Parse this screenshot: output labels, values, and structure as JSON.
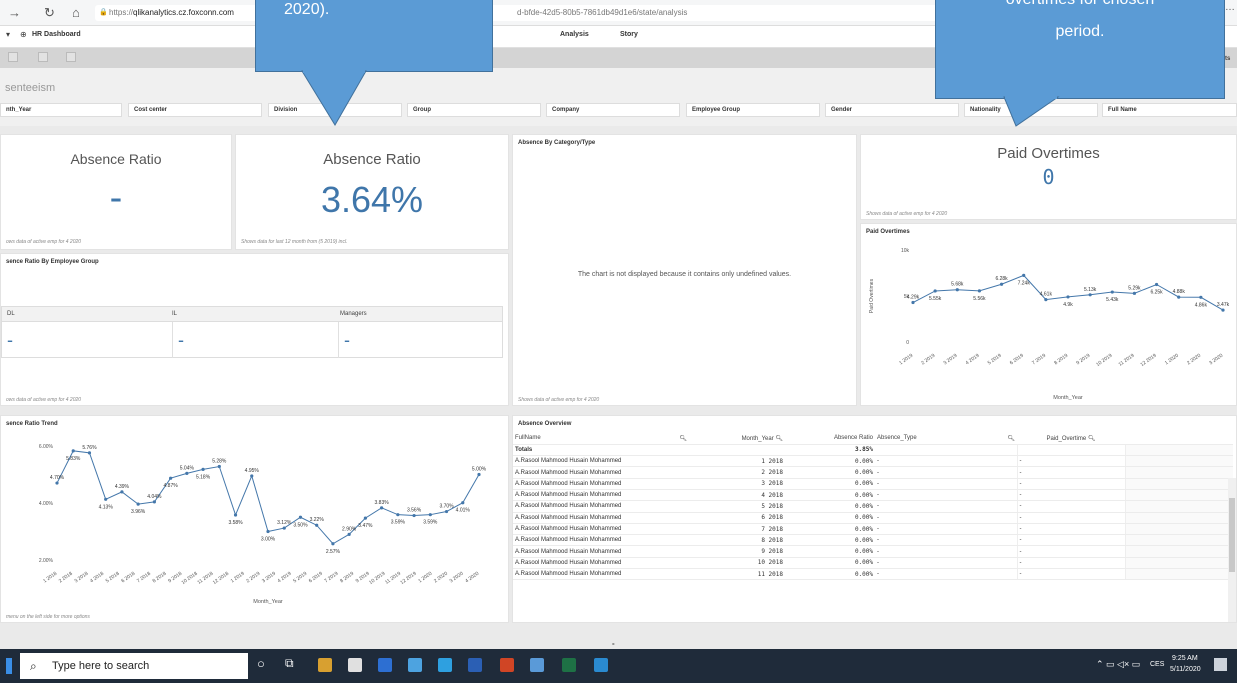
{
  "browser": {
    "url_prefix": "https://",
    "url_host": "qlikanalytics.cz.foxconn.com",
    "url_rest": "d-bfde-42d5-80b5-7861db49d1e6/state/analysis"
  },
  "app": {
    "name": "HR Dashboard",
    "tabs": [
      "Analysis",
      "Story"
    ],
    "toolbar_right": "ts"
  },
  "sheet": {
    "title": "senteeism"
  },
  "filters": [
    "nth_Year",
    "Cost center",
    "Division",
    "Group",
    "Company",
    "Employee Group",
    "Gender",
    "Nationality",
    "Full Name"
  ],
  "kpi_left": {
    "title": "Absence Ratio",
    "value": "-",
    "footer": "ows data of active emp for 4 2020"
  },
  "kpi_mid": {
    "title": "Absence Ratio",
    "value": "3.64%",
    "footer": "Shows data for last 12 month from (5 2019) incl."
  },
  "category": {
    "title": "Absence By Category/Type",
    "message": "The chart is not displayed because it contains only undefined values.",
    "footer": "Shows data of active emp for 4 2020"
  },
  "paid_kpi": {
    "title": "Paid Overtimes",
    "value": "0",
    "footer": "Shows data of active emp for 4 2020"
  },
  "emp_group": {
    "title": "sence Ratio By Employee Group",
    "columns": [
      "DL",
      "IL",
      "Managers"
    ],
    "values": [
      "-",
      "-",
      "-"
    ],
    "footer": "ows data of active emp for 4 2020"
  },
  "trend": {
    "title": "sence Ratio Trend",
    "footer": "menu on the left side for more options"
  },
  "overview": {
    "title": "Absence Overview",
    "headers": [
      "FullName",
      "Month_Year",
      "Absence Ratio",
      "Absence_Type",
      "Paid_Overtime"
    ],
    "totals": [
      "Totals",
      "",
      "3.85%",
      "",
      ""
    ],
    "rows": [
      [
        "A.Rasool Mahmood Husain Mohammed",
        "1 2018",
        "0.00%",
        "-",
        "-"
      ],
      [
        "A.Rasool Mahmood Husain Mohammed",
        "2 2018",
        "0.00%",
        "-",
        "-"
      ],
      [
        "A.Rasool Mahmood Husain Mohammed",
        "3 2018",
        "0.00%",
        "-",
        "-"
      ],
      [
        "A.Rasool Mahmood Husain Mohammed",
        "4 2018",
        "0.00%",
        "-",
        "-"
      ],
      [
        "A.Rasool Mahmood Husain Mohammed",
        "5 2018",
        "0.00%",
        "-",
        "-"
      ],
      [
        "A.Rasool Mahmood Husain Mohammed",
        "6 2018",
        "0.00%",
        "-",
        "-"
      ],
      [
        "A.Rasool Mahmood Husain Mohammed",
        "7 2018",
        "0.00%",
        "-",
        "-"
      ],
      [
        "A.Rasool Mahmood Husain Mohammed",
        "8 2018",
        "0.00%",
        "-",
        "-"
      ],
      [
        "A.Rasool Mahmood Husain Mohammed",
        "9 2018",
        "0.00%",
        "-",
        "-"
      ],
      [
        "A.Rasool Mahmood Husain Mohammed",
        "10 2018",
        "0.00%",
        "-",
        "-"
      ],
      [
        "A.Rasool Mahmood Husain Mohammed",
        "11 2018",
        "0.00%",
        "-",
        "-"
      ]
    ]
  },
  "callouts": {
    "left": "2020).",
    "right_line1": "overtimes for chosen",
    "right_line2": "period."
  },
  "dash_below": "-",
  "taskbar": {
    "search_placeholder": "Type here to search",
    "lang": "CES",
    "time": "9:25 AM",
    "date": "5/11/2020"
  },
  "chart_data": [
    {
      "type": "line",
      "title": "Paid Overtimes",
      "xlabel": "Month_Year",
      "ylabel": "Paid Overtimes",
      "y_ticks": [
        "0",
        "5k",
        "10k"
      ],
      "ylim": [
        0,
        10000
      ],
      "categories": [
        "1 2019",
        "2 2019",
        "3 2019",
        "4 2019",
        "5 2019",
        "6 2019",
        "7 2019",
        "8 2019",
        "9 2019",
        "10 2019",
        "11 2019",
        "12 2019",
        "1 2020",
        "2 2020",
        "3 2020"
      ],
      "values": [
        4290,
        5550,
        5680,
        5560,
        6280,
        7240,
        4610,
        4900,
        5130,
        5430,
        5290,
        6250,
        4880,
        4860,
        3470
      ],
      "labels": [
        "4.29k",
        "5.55k",
        "5.68k",
        "5.56k",
        "6.28k",
        "7.24k",
        "4.61k",
        "4.9k",
        "5.13k",
        "5.43k",
        "5.29k",
        "6.25k",
        "4.88k",
        "4.86k",
        "3.47k"
      ],
      "color": "#4477aa"
    },
    {
      "type": "line",
      "title": "Absence Ratio Trend",
      "xlabel": "Month_Year",
      "y_ticks": [
        "2.00%",
        "4.00%",
        "6.00%"
      ],
      "ylim": [
        2,
        6
      ],
      "categories": [
        "1 2018",
        "2 2018",
        "3 2018",
        "4 2018",
        "5 2018",
        "6 2018",
        "7 2018",
        "8 2018",
        "9 2018",
        "10 2018",
        "11 2018",
        "12 2018",
        "1 2019",
        "2 2019",
        "3 2019",
        "4 2019",
        "5 2019",
        "6 2019",
        "7 2019",
        "8 2019",
        "9 2019",
        "10 2019",
        "11 2019",
        "12 2019",
        "1 2020",
        "2 2020",
        "3 2020",
        "4 2020"
      ],
      "values": [
        4.7,
        5.83,
        5.76,
        4.13,
        4.39,
        3.96,
        4.04,
        4.87,
        5.04,
        5.18,
        5.28,
        3.58,
        4.95,
        3.0,
        3.12,
        3.5,
        3.22,
        2.57,
        2.9,
        3.47,
        3.83,
        3.59,
        3.56,
        3.59,
        3.7,
        4.01,
        5.0
      ],
      "labels": [
        "4.70%",
        "5.83%",
        "5.76%",
        "4.13%",
        "4.39%",
        "3.96%",
        "4.04%",
        "4.87%",
        "5.04%",
        "5.18%",
        "5.28%",
        "3.58%",
        "4.95%",
        "3.00%",
        "3.12%",
        "3.50%",
        "3.22%",
        "2.57%",
        "2.90%",
        "3.47%",
        "3.83%",
        "3.59%",
        "3.56%",
        "3.59%",
        "3.70%",
        "4.01%",
        "5.00%"
      ],
      "color": "#4477aa"
    }
  ]
}
